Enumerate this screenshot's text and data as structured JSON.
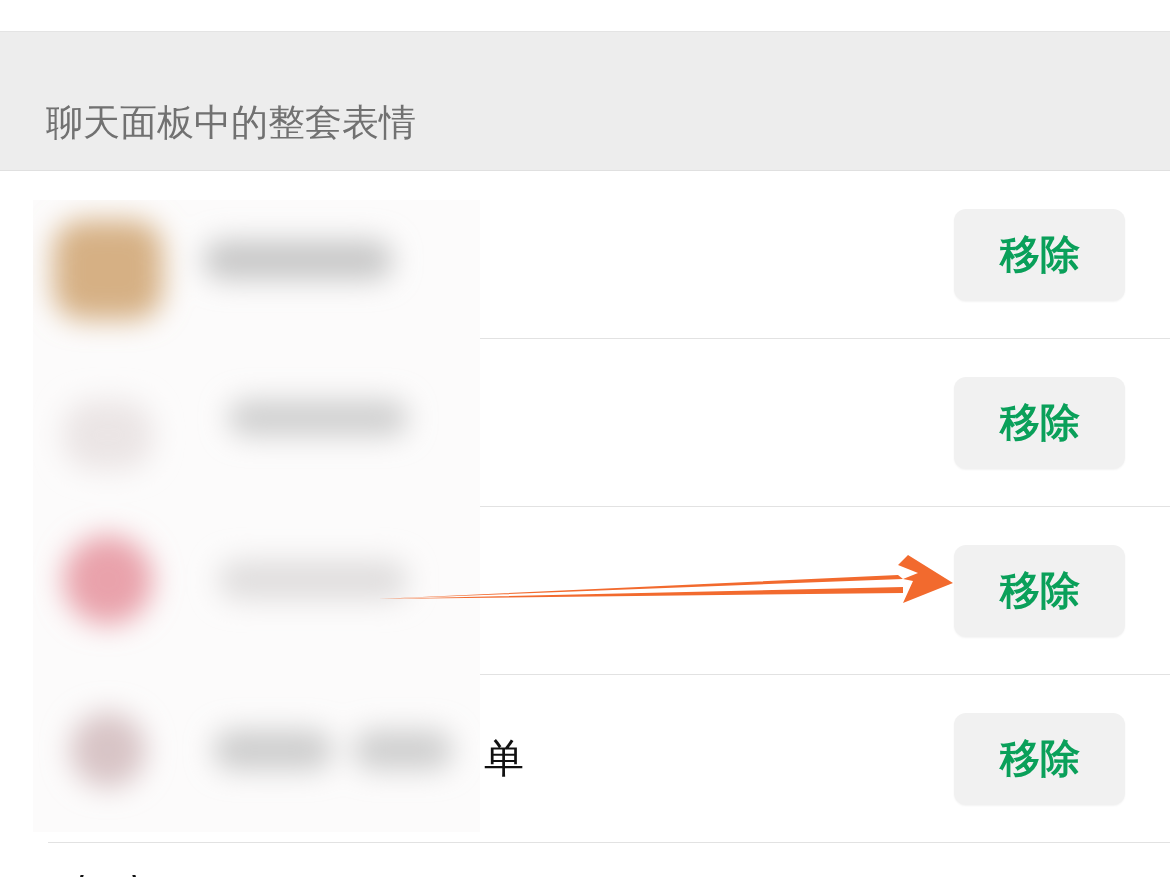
{
  "section_header": "聊天面板中的整套表情",
  "sticker_packs": [
    {
      "remove_button": "移除"
    },
    {
      "remove_button": "移除"
    },
    {
      "remove_button": "移除"
    },
    {
      "name": "单",
      "remove_button": "移除"
    }
  ]
}
